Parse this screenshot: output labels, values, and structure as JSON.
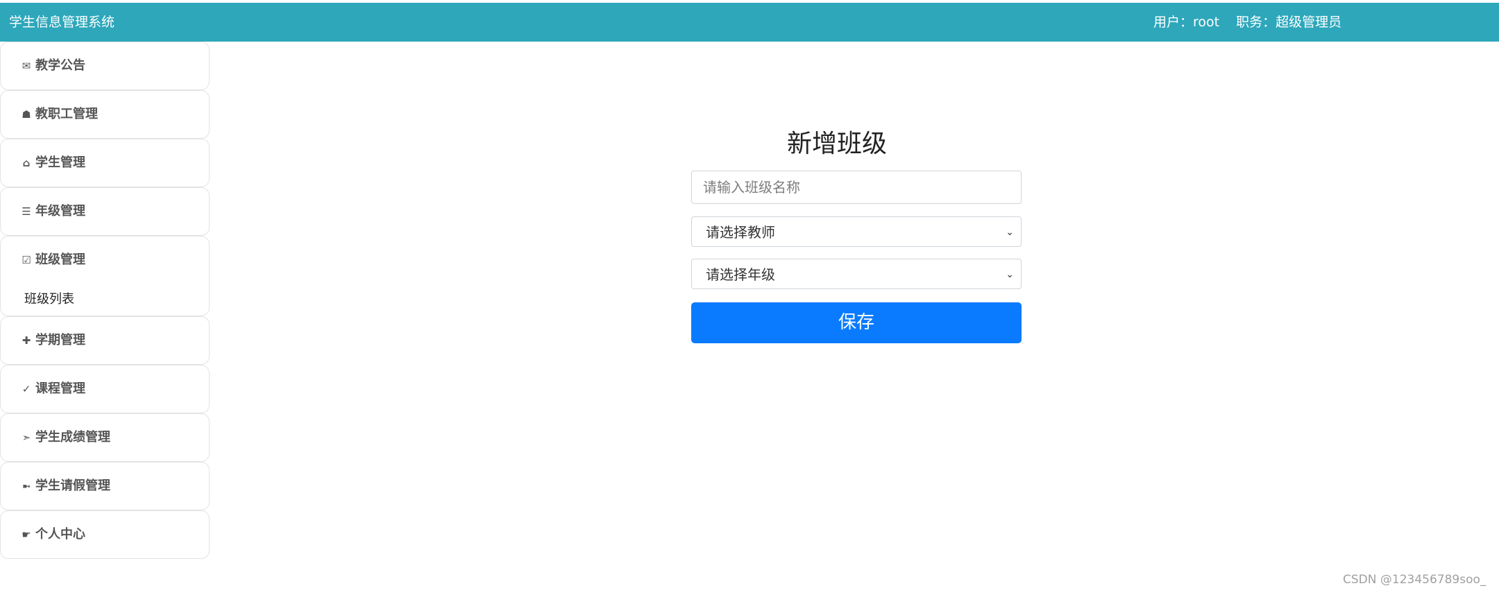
{
  "header": {
    "title": "学生信息管理系统",
    "user_label": "用户：",
    "user_value": "root",
    "role_label": "职务：",
    "role_value": "超级管理员",
    "background": "#2ea7bb"
  },
  "sidebar": {
    "items": [
      {
        "label": "教学公告",
        "icon": "envelope-icon",
        "glyph": "✉"
      },
      {
        "label": "教职工管理",
        "icon": "bell-icon",
        "glyph": "☗"
      },
      {
        "label": "学生管理",
        "icon": "home-icon",
        "glyph": "⌂"
      },
      {
        "label": "年级管理",
        "icon": "list-icon",
        "glyph": "☰"
      },
      {
        "label": "班级管理",
        "icon": "check-box-icon",
        "glyph": "☑",
        "submenu": [
          "班级列表"
        ]
      },
      {
        "label": "学期管理",
        "icon": "plus-icon",
        "glyph": "✚"
      },
      {
        "label": "课程管理",
        "icon": "check-icon",
        "glyph": "✓"
      },
      {
        "label": "学生成绩管理",
        "icon": "arrow-right-icon",
        "glyph": "➣"
      },
      {
        "label": "学生请假管理",
        "icon": "arrow-out-icon",
        "glyph": "➼"
      },
      {
        "label": "个人中心",
        "icon": "hand-pointer-icon",
        "glyph": "☛"
      }
    ]
  },
  "form": {
    "title": "新增班级",
    "class_name_placeholder": "请输入班级名称",
    "teacher_select_value": "请选择教师",
    "grade_select_value": "请选择年级",
    "save_label": "保存",
    "accent": "#0a7bff"
  },
  "watermark": "CSDN @123456789soo_"
}
